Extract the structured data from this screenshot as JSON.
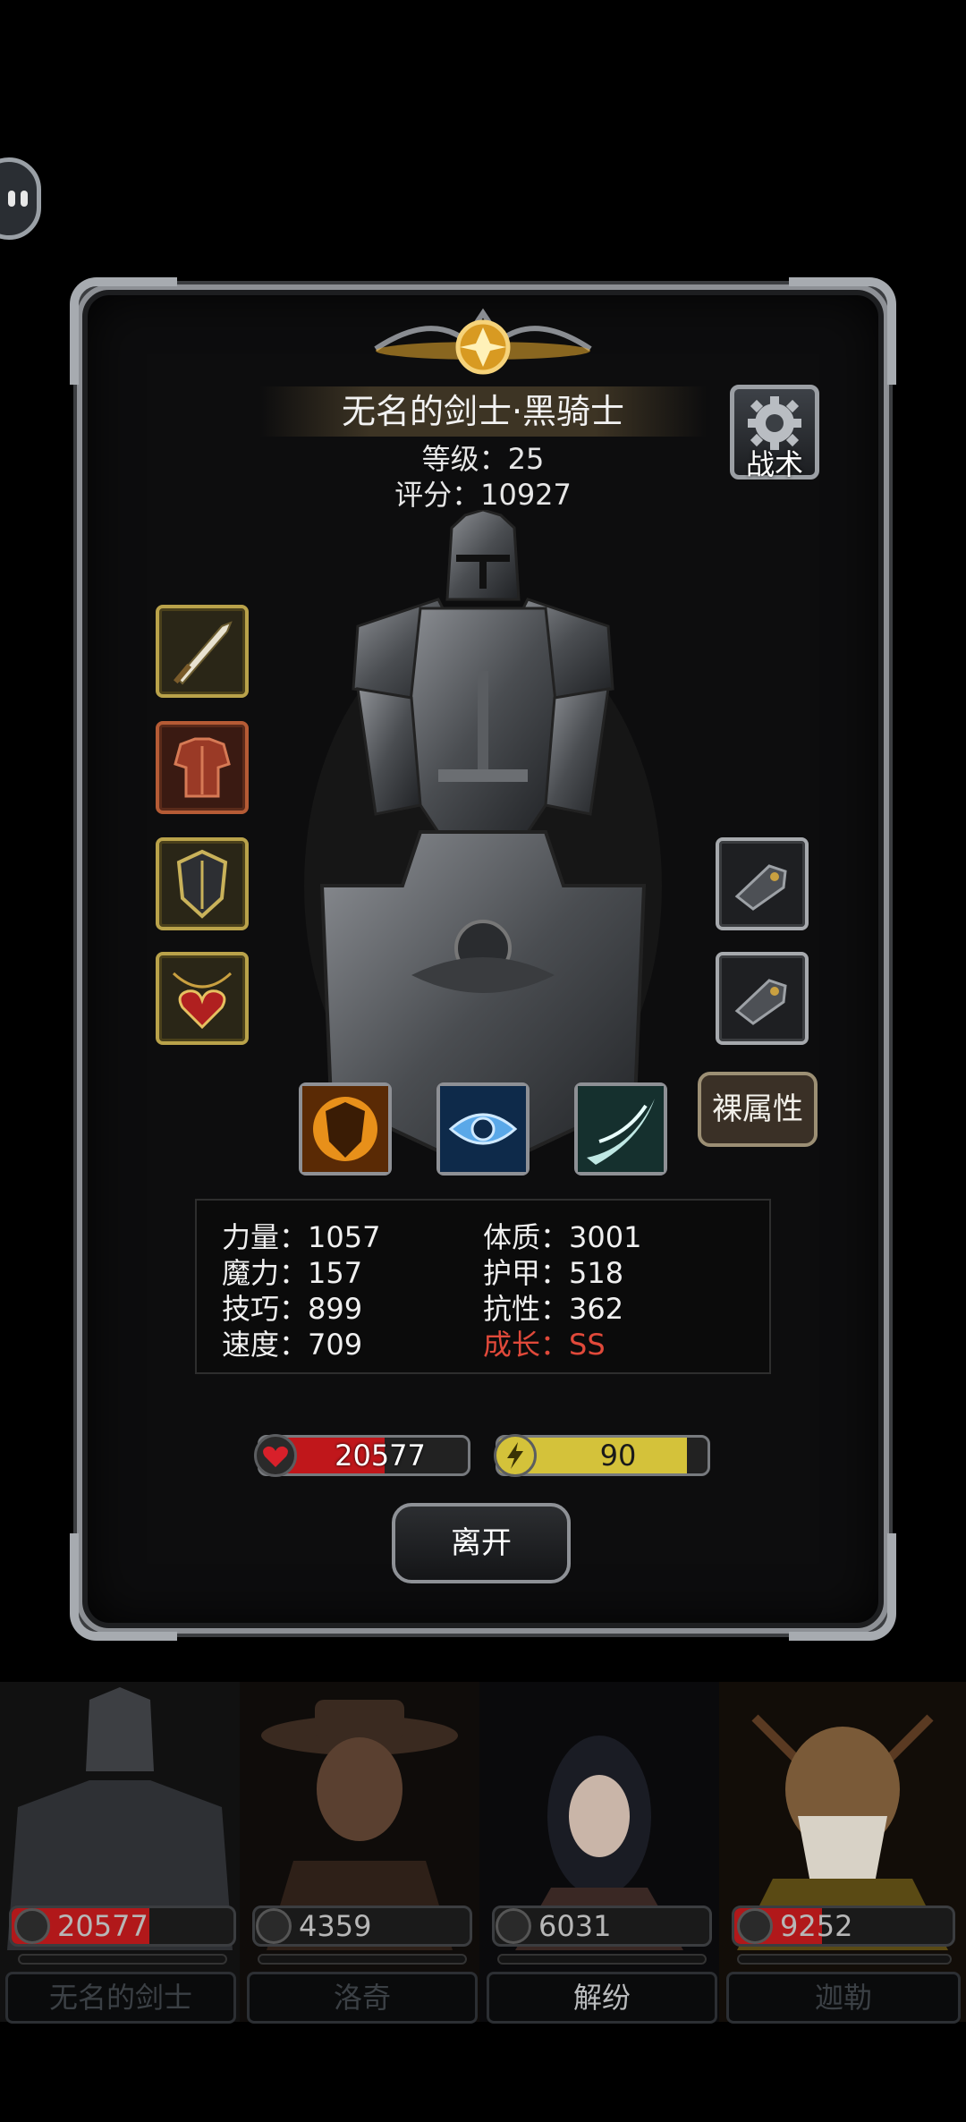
{
  "hero": {
    "name": "无名的剑士·黑骑士",
    "level": "等级：25",
    "score": "评分：10927",
    "tactics_label": "战术",
    "bare_stats_label": "裸属性"
  },
  "equipment_left": [
    {
      "icon": "sword-icon"
    },
    {
      "icon": "chest-armor-icon"
    },
    {
      "icon": "shield-armor-icon"
    },
    {
      "icon": "heart-amulet-icon"
    }
  ],
  "equipment_right": [
    {
      "icon": "gauntlet-icon"
    },
    {
      "icon": "gauntlet-icon"
    }
  ],
  "skills": [
    {
      "icon": "fire-shield-skill-icon"
    },
    {
      "icon": "eye-skill-icon"
    },
    {
      "icon": "slash-skill-icon"
    }
  ],
  "stats": {
    "strength": "力量：1057",
    "magic": "魔力：157",
    "skill": "技巧：899",
    "speed": "速度：709",
    "constitution": "体质：3001",
    "armor": "护甲：518",
    "resistance": "抗性：362",
    "growth": "成长：SS"
  },
  "hp_bar": {
    "value": "20577",
    "fill": 0.6
  },
  "energy_bar": {
    "value": "90",
    "fill": 0.9
  },
  "leave_label": "离开",
  "roster": [
    {
      "name": "无名的剑士",
      "hp": "20577",
      "hp_fill": 0.62,
      "active": false
    },
    {
      "name": "洛奇",
      "hp": "4359",
      "hp_fill": 0.0,
      "active": false
    },
    {
      "name": "解纷",
      "hp": "6031",
      "hp_fill": 0.0,
      "active": true
    },
    {
      "name": "迦勒",
      "hp": "9252",
      "hp_fill": 0.4,
      "active": false
    }
  ],
  "colors": {
    "hp": "#c0171b",
    "energy": "#d4c23a",
    "gold_frame": "#b9a24a",
    "growth_text": "#e0493a"
  }
}
